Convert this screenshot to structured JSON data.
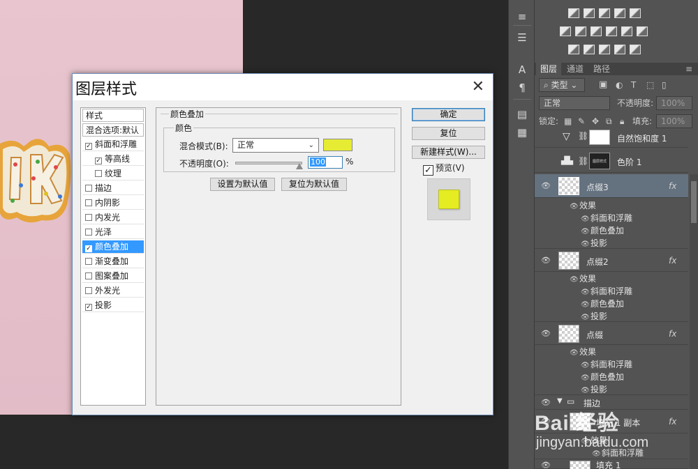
{
  "dialog": {
    "title": "图层样式",
    "styles_header": "样式",
    "blending_options": "混合选项:默认",
    "items": [
      {
        "label": "斜面和浮雕",
        "checked": true,
        "indent": false
      },
      {
        "label": "等高线",
        "checked": true,
        "indent": true
      },
      {
        "label": "纹理",
        "checked": false,
        "indent": true
      },
      {
        "label": "描边",
        "checked": false,
        "indent": false
      },
      {
        "label": "内阴影",
        "checked": false,
        "indent": false
      },
      {
        "label": "内发光",
        "checked": false,
        "indent": false
      },
      {
        "label": "光泽",
        "checked": false,
        "indent": false
      },
      {
        "label": "颜色叠加",
        "checked": true,
        "indent": false,
        "selected": true
      },
      {
        "label": "渐变叠加",
        "checked": false,
        "indent": false
      },
      {
        "label": "图案叠加",
        "checked": false,
        "indent": false
      },
      {
        "label": "外发光",
        "checked": false,
        "indent": false
      },
      {
        "label": "投影",
        "checked": true,
        "indent": false
      }
    ],
    "section_title": "颜色叠加",
    "group_title": "颜色",
    "blend_mode_label": "混合模式(B):",
    "blend_mode_value": "正常",
    "overlay_color": "#e6ec33",
    "opacity_label": "不透明度(O):",
    "opacity_value": "100",
    "opacity_unit": "%",
    "opacity_level": 1.0,
    "set_default_button": "设置为默认值",
    "reset_default_button": "复位为默认值",
    "ok_button": "确定",
    "reset_button": "复位",
    "new_style_button": "新建样式(W)...",
    "preview_label": "预览(V)",
    "preview_checked": true
  },
  "layers_panel": {
    "tabs": [
      "图层",
      "通道",
      "路径"
    ],
    "kind_filter": "类型",
    "blend_mode": "正常",
    "opacity_label": "不透明度:",
    "opacity_value": "100%",
    "lock_label": "锁定:",
    "fill_label": "填充:",
    "fill_value": "100%",
    "layers": [
      {
        "name": "自然饱和度 1"
      },
      {
        "name": "色阶 1",
        "thumb_text": "图层样式"
      },
      {
        "name": "点缀3",
        "fx": "fx",
        "effects_label": "效果",
        "effects": [
          "斜面和浮雕",
          "颜色叠加",
          "投影"
        ]
      },
      {
        "name": "点缀2",
        "fx": "fx",
        "effects_label": "效果",
        "effects": [
          "斜面和浮雕",
          "颜色叠加",
          "投影"
        ]
      },
      {
        "name": "点缀",
        "fx": "fx",
        "effects_label": "效果",
        "effects": [
          "斜面和浮雕",
          "颜色叠加",
          "投影"
        ]
      },
      {
        "name": "描边"
      },
      {
        "name": "填充 1 副本",
        "fx": "fx",
        "effects_label": "效果",
        "effects": [
          "斜面和浮雕"
        ]
      },
      {
        "name": "填充 1"
      }
    ]
  },
  "watermark": {
    "logo": "Bai 经验",
    "url": "jingyan.baidu.com"
  }
}
